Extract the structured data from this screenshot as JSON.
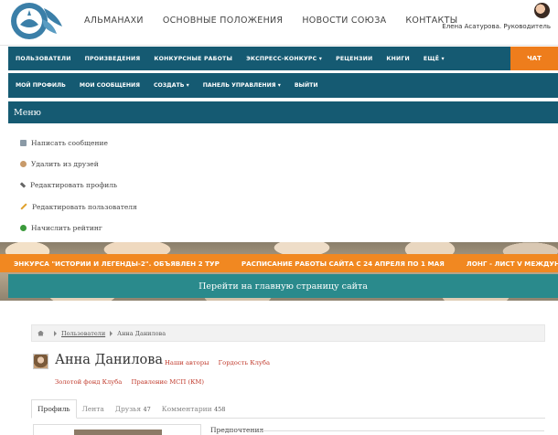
{
  "header": {
    "nav": [
      "АЛЬМАНАХИ",
      "ОСНОВНЫЕ ПОЛОЖЕНИЯ",
      "НОВОСТИ СОЮЗА",
      "КОНТАКТЫ"
    ],
    "user": "Елена Асатурова. Руководитель"
  },
  "main_nav": {
    "items": [
      "ПОЛЬЗОВАТЕЛИ",
      "ПРОИЗВЕДЕНИЯ",
      "КОНКУРСНЫЕ РАБОТЫ",
      "ЭКСПРЕСС-КОНКУРС ▾",
      "РЕЦЕНЗИИ",
      "КНИГИ",
      "ЕЩЁ ▾"
    ],
    "chat": "ЧАТ"
  },
  "sub_nav": {
    "items": [
      "МОЙ ПРОФИЛЬ",
      "МОИ СООБЩЕНИЯ",
      "СОЗДАТЬ ▾",
      "ПАНЕЛЬ УПРАВЛЕНИЯ ▾",
      "ВЫЙТИ"
    ]
  },
  "menu": {
    "title": "Меню",
    "items": [
      "Написать сообщение",
      "Удалить из друзей",
      "Редактировать профиль",
      "Редактировать пользователя",
      "Начислить рейтинг"
    ]
  },
  "ticker": [
    "ЭНКУРСА \"ИСТОРИИ И ЛЕГЕНДЫ-2\". ОБЪЯВЛЕН 2 ТУР",
    "РАСПИСАНИЕ РАБОТЫ САЙТА С 24 АПРЕЛЯ ПО 1 МАЯ",
    "ЛОНГ - ЛИСТ V МЕЖДУНАРОДНОГО Л"
  ],
  "go_home": "Перейти на главную страницу сайта",
  "breadcrumb": {
    "link": "Пользователи",
    "current": "Анна Данилова"
  },
  "profile": {
    "name": "Анна Данилова",
    "groups1": [
      "Наши авторы",
      "Гордость Клуба"
    ],
    "groups2": [
      "Золотой фонд Клуба",
      "Правление МСП (КМ)"
    ]
  },
  "tabs": [
    {
      "label": "Профиль",
      "count": ""
    },
    {
      "label": "Лента",
      "count": ""
    },
    {
      "label": "Друзья",
      "count": "47"
    },
    {
      "label": "Комментарии",
      "count": "458"
    }
  ],
  "preferences_label": "Предпочтения",
  "colors": {
    "nav_bg": "#155a72",
    "chat_bg": "#ee7d1c",
    "ticker_bg": "#f18821",
    "go_home_bg": "#2a8a8c",
    "link_red": "#c0392b"
  }
}
